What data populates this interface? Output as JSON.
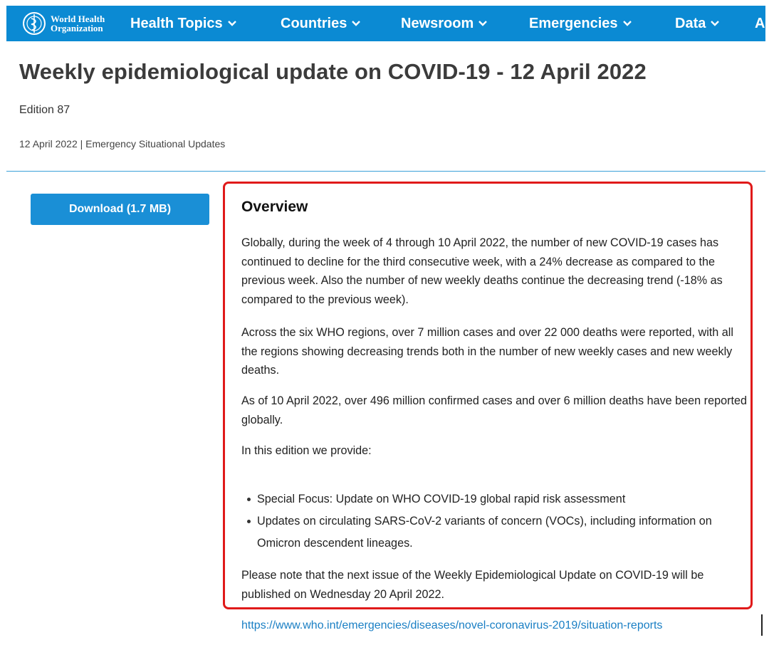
{
  "nav": {
    "logo_line1": "World Health",
    "logo_line2": "Organization",
    "items": [
      {
        "label": "Health Topics"
      },
      {
        "label": "Countries"
      },
      {
        "label": "Newsroom"
      },
      {
        "label": "Emergencies"
      },
      {
        "label": "Data"
      },
      {
        "label": "A"
      }
    ],
    "color": "#0b8ad3"
  },
  "header": {
    "title": "Weekly epidemiological update on COVID-19 - 12 April 2022",
    "edition": "Edition 87",
    "meta": "12 April 2022 | Emergency Situational Updates"
  },
  "download": {
    "label": "Download (1.7 MB)"
  },
  "overview": {
    "title": "Overview",
    "paragraphs": [
      "Globally, during the week of 4 through 10 April 2022, the number of new COVID-19 cases has continued to decline for the third consecutive week, with a 24% decrease as compared to the previous week. Also the number of new weekly deaths continue the decreasing trend (-18% as compared to the previous week).",
      "Across the six WHO regions, over 7 million cases and over 22 000 deaths were reported, with all the regions showing decreasing trends both in the number of new weekly cases and new weekly deaths.",
      "As of 10 April 2022, over 496 million confirmed cases and over 6 million deaths have been reported globally.",
      "In this edition we provide:"
    ],
    "bullets": [
      "Special Focus: Update on WHO COVID-19 global rapid risk assessment",
      "Updates on circulating SARS-CoV-2 variants of concern (VOCs), including information on Omicron descendent lineages."
    ],
    "note": "Please note that the next issue of the Weekly Epidemiological Update on COVID-19 will be published on Wednesday 20 April 2022.",
    "highlight_color": "#e01a1a"
  },
  "source_link": "https://www.who.int/emergencies/diseases/novel-coronavirus-2019/situation-reports"
}
